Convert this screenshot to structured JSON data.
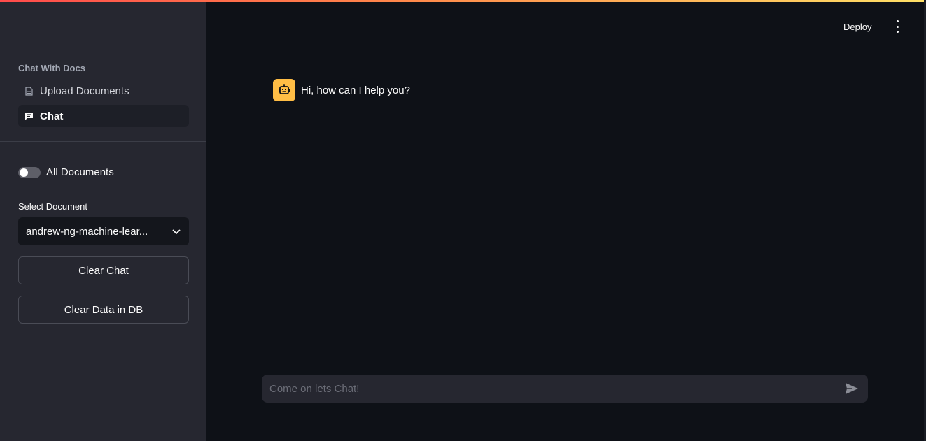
{
  "sidebar": {
    "nav_header": "Chat With Docs",
    "nav_items": [
      {
        "label": "Upload Documents",
        "icon": "document-icon",
        "active": false
      },
      {
        "label": "Chat",
        "icon": "chat-icon",
        "active": true
      }
    ],
    "toggle": {
      "label": "All Documents",
      "checked": false
    },
    "select": {
      "label": "Select Document",
      "value": "andrew-ng-machine-lear..."
    },
    "buttons": {
      "clear_chat": "Clear Chat",
      "clear_db": "Clear Data in DB"
    }
  },
  "header": {
    "deploy_label": "Deploy",
    "menu_icon": "vertical-dots-icon"
  },
  "chat": {
    "messages": [
      {
        "role": "assistant",
        "avatar_icon": "robot-icon",
        "text": "Hi, how can I help you?"
      }
    ],
    "input": {
      "placeholder": "Come on lets Chat!",
      "value": ""
    },
    "send_icon": "send-icon"
  },
  "colors": {
    "sidebar_bg": "#262730",
    "main_bg": "#0e1117",
    "avatar_bg": "#ffbd45",
    "accent_gradient_start": "#ff4b4b",
    "accent_gradient_end": "#ffe066"
  }
}
